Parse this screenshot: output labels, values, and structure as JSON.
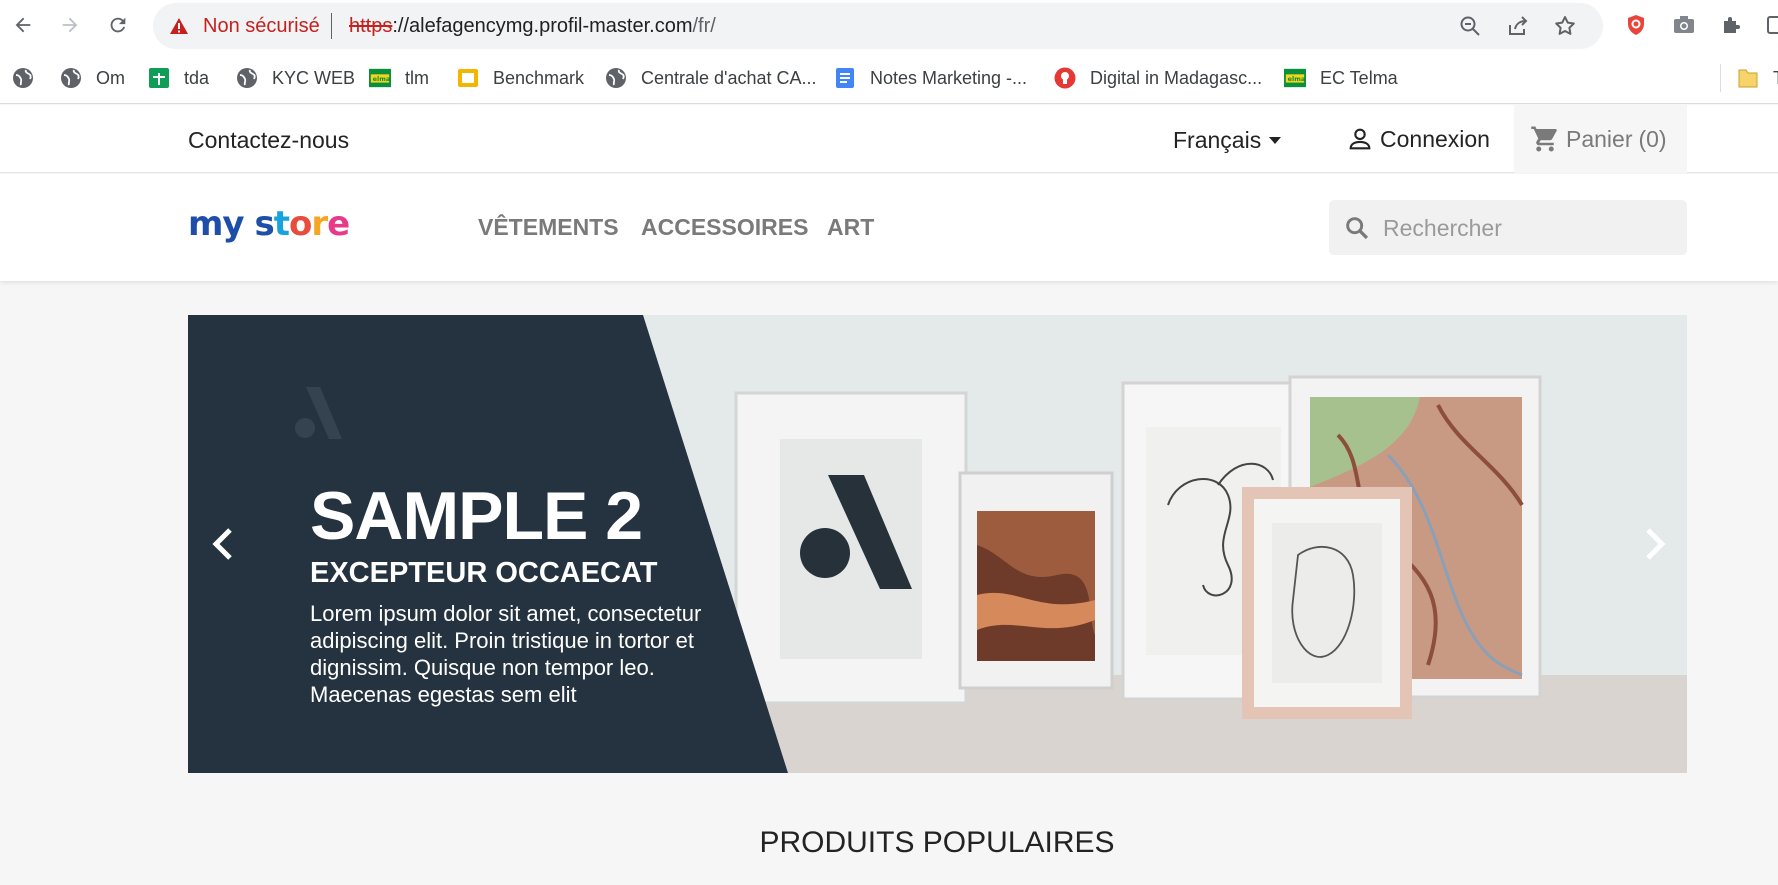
{
  "browser": {
    "security_label": "Non sécurisé",
    "url_scheme": "https",
    "url_host": "://alefagencymg.profil-master.com",
    "url_path": "/fr/",
    "bookmarks": [
      {
        "label": "",
        "icon": "globe-icon"
      },
      {
        "label": "Om",
        "icon": "globe-icon"
      },
      {
        "label": "tda",
        "icon": "sheets-icon"
      },
      {
        "label": "KYC WEB",
        "icon": "globe-icon"
      },
      {
        "label": "tlm",
        "icon": "telma-icon"
      },
      {
        "label": "Benchmark",
        "icon": "slides-icon"
      },
      {
        "label": "Centrale d'achat CA...",
        "icon": "globe-icon"
      },
      {
        "label": "Notes Marketing -...",
        "icon": "docs-icon"
      },
      {
        "label": "Digital in Madagasc...",
        "icon": "bulb-icon"
      },
      {
        "label": "EC Telma",
        "icon": "telma-icon"
      },
      {
        "label": "T",
        "icon": "folder-icon"
      }
    ]
  },
  "header": {
    "contact_label": "Contactez-nous",
    "language_label": "Français",
    "login_label": "Connexion",
    "cart_label": "Panier",
    "cart_count": "(0)"
  },
  "nav": {
    "logo_text": "my store",
    "menu": [
      "VÊTEMENTS",
      "ACCESSOIRES",
      "ART"
    ],
    "search_placeholder": "Rechercher"
  },
  "carousel": {
    "title": "SAMPLE 2",
    "subtitle": "EXCEPTEUR OCCAECAT",
    "description": "Lorem ipsum dolor sit amet, consectetur adipiscing elit. Proin tristique in tortor et dignissim. Quisque non tempor leo. Maecenas egestas sem elit"
  },
  "section": {
    "title": "PRODUITS POPULAIRES"
  },
  "colors": {
    "banner_dark": "#253340",
    "warning_red": "#c5221f",
    "accent_blue": "#1a73e8"
  }
}
